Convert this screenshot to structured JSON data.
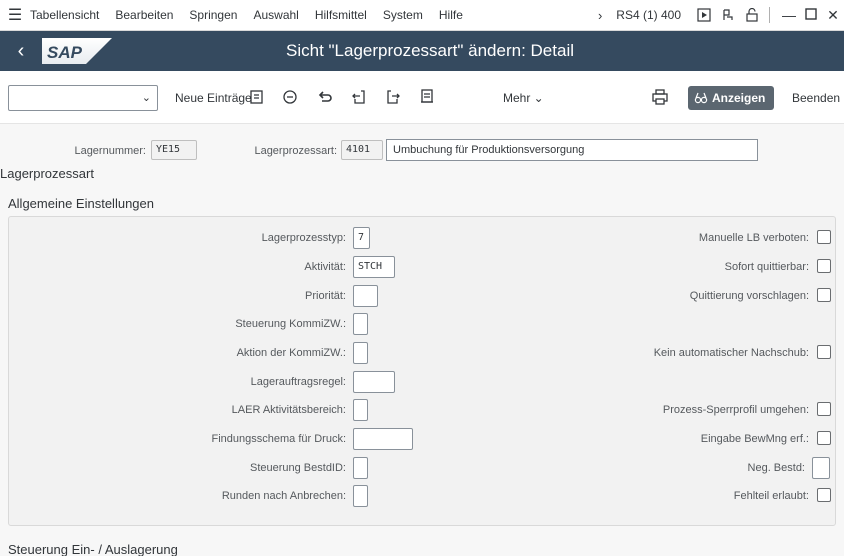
{
  "menubar": {
    "items": [
      "Tabellensicht",
      "Bearbeiten",
      "Springen",
      "Auswahl",
      "Hilfsmittel",
      "System",
      "Hilfe"
    ],
    "system_info": "RS4 (1) 400"
  },
  "titlebar": {
    "logo_text": "SAP",
    "title": "Sicht \"Lagerprozessart\" ändern: Detail"
  },
  "toolbar": {
    "command_field_value": "",
    "new_entries_label": "Neue Einträge",
    "more_label": "Mehr",
    "display_label": "Anzeigen",
    "exit_label": "Beenden"
  },
  "header": {
    "warehouse_label": "Lagernummer:",
    "warehouse_value": "YE15",
    "process_type_label": "Lagerprozessart:",
    "process_type_value": "4101",
    "process_type_desc": "Umbuchung für Produktionsversorgung"
  },
  "section_title": "Lagerprozessart",
  "general": {
    "title": "Allgemeine Einstellungen",
    "left_fields": [
      {
        "label": "Lagerprozesstyp:",
        "value": "7"
      },
      {
        "label": "Aktivität:",
        "value": "STCH"
      },
      {
        "label": "Priorität:",
        "value": ""
      },
      {
        "label": "Steuerung KommiZW.:",
        "value": ""
      },
      {
        "label": "Aktion der KommiZW.:",
        "value": ""
      },
      {
        "label": "Lagerauftragsregel:",
        "value": ""
      },
      {
        "label": "LAER Aktivitätsbereich:",
        "value": ""
      },
      {
        "label": "Findungsschema für Druck:",
        "value": ""
      },
      {
        "label": "Steuerung BestdID:",
        "value": ""
      },
      {
        "label": "Runden nach Anbrechen:",
        "value": ""
      }
    ],
    "right_fields": [
      {
        "label": "Manuelle LB verboten:",
        "checked": false
      },
      {
        "label": "Sofort quittierbar:",
        "checked": false
      },
      {
        "label": "Quittierung vorschlagen:",
        "checked": false
      },
      {
        "label": "Kein automatischer Nachschub:",
        "checked": false
      },
      {
        "label": "Prozess-Sperrprofil umgehen:",
        "checked": false
      },
      {
        "label": "Eingabe BewMng erf.:",
        "checked": false
      },
      {
        "label": "Neg. Bestd:",
        "value": ""
      },
      {
        "label": "Fehlteil erlaubt:",
        "checked": false
      }
    ]
  },
  "next_section_title": "Steuerung Ein- / Auslagerung"
}
